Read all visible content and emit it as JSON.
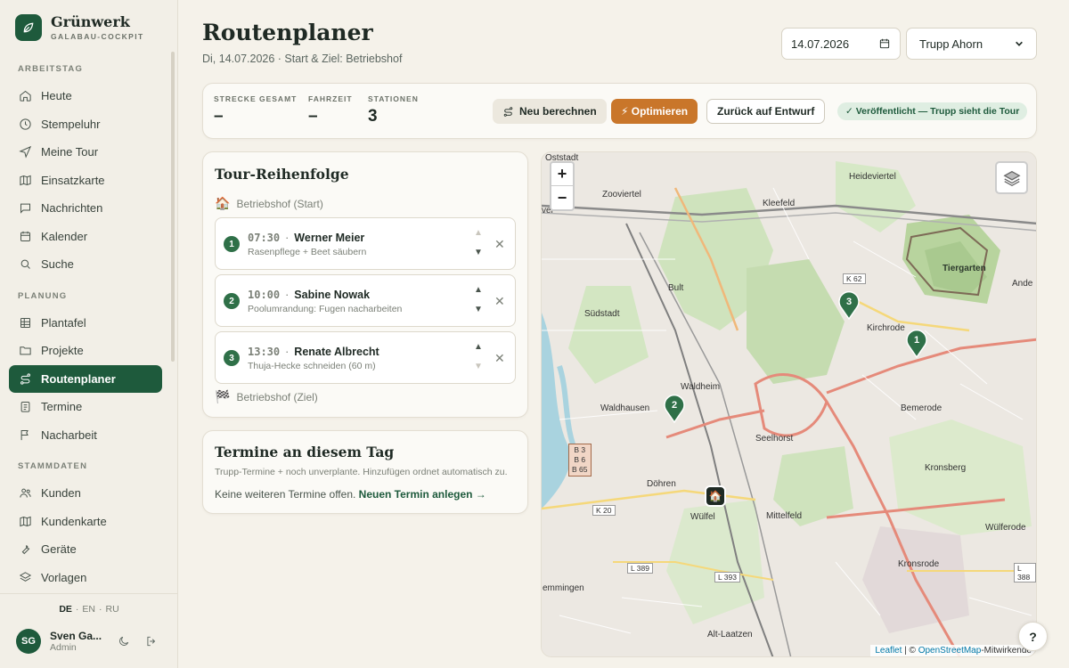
{
  "brand": {
    "name": "Grünwerk",
    "subtitle": "GALABAU-COCKPIT"
  },
  "nav": {
    "sections": [
      {
        "label": "ARBEITSTAG",
        "items": [
          {
            "label": "Heute",
            "icon": "home-icon"
          },
          {
            "label": "Stempeluhr",
            "icon": "clock-icon"
          },
          {
            "label": "Meine Tour",
            "icon": "navigation-icon"
          },
          {
            "label": "Einsatzkarte",
            "icon": "map-icon"
          },
          {
            "label": "Nachrichten",
            "icon": "message-icon"
          },
          {
            "label": "Kalender",
            "icon": "calendar-icon"
          },
          {
            "label": "Suche",
            "icon": "search-icon"
          }
        ]
      },
      {
        "label": "PLANUNG",
        "items": [
          {
            "label": "Plantafel",
            "icon": "grid-icon"
          },
          {
            "label": "Projekte",
            "icon": "folder-icon"
          },
          {
            "label": "Routenplaner",
            "icon": "route-icon",
            "active": true
          },
          {
            "label": "Termine",
            "icon": "clipboard-icon"
          },
          {
            "label": "Nacharbeit",
            "icon": "flag-icon"
          }
        ]
      },
      {
        "label": "STAMMDATEN",
        "items": [
          {
            "label": "Kunden",
            "icon": "users-icon"
          },
          {
            "label": "Kundenkarte",
            "icon": "map-icon"
          },
          {
            "label": "Geräte",
            "icon": "tool-icon"
          },
          {
            "label": "Vorlagen",
            "icon": "layers-icon"
          }
        ]
      }
    ]
  },
  "languages": [
    "DE",
    "EN",
    "RU"
  ],
  "user": {
    "initials": "SG",
    "name": "Sven Ga...",
    "role": "Admin"
  },
  "header": {
    "title": "Routenplaner",
    "subtitle": "Di, 14.07.2026 · Start & Ziel: Betriebshof",
    "date_value": "14.07.2026",
    "team_value": "Trupp Ahorn"
  },
  "stats": {
    "distance_label": "STRECKE GESAMT",
    "distance_value": "–",
    "duration_label": "FAHRZEIT",
    "duration_value": "–",
    "stations_label": "STATIONEN",
    "stations_value": "3"
  },
  "actions": {
    "recalc": "Neu berechnen",
    "optimize": "⚡ Optimieren",
    "draft": "Zurück auf Entwurf",
    "published": "✓ Veröffentlicht — Trupp sieht die Tour"
  },
  "tour": {
    "title": "Tour-Reihenfolge",
    "start": "Betriebshof (Start)",
    "end": "Betriebshof (Ziel)",
    "stops": [
      {
        "num": "1",
        "time": "07:30",
        "name": "Werner Meier",
        "desc": "Rasenpflege + Beet säubern"
      },
      {
        "num": "2",
        "time": "10:00",
        "name": "Sabine Nowak",
        "desc": "Poolumrandung: Fugen nacharbeiten"
      },
      {
        "num": "3",
        "time": "13:30",
        "name": "Renate Albrecht",
        "desc": "Thuja-Hecke schneiden (60 m)"
      }
    ]
  },
  "termine": {
    "title": "Termine an diesem Tag",
    "hint": "Trupp-Termine + noch unverplante. Hinzufügen ordnet automatisch zu.",
    "empty": "Keine weiteren Termine offen. ",
    "link": "Neuen Termin anlegen →"
  },
  "map": {
    "labels": [
      "Oststadt",
      "Zooviertel",
      "Kleefeld",
      "Heideviertel",
      "Südstadt",
      "Bult",
      "Tiergarten",
      "Kirchrode",
      "Waldheim",
      "Waldhausen",
      "Bemerode",
      "Seelhorst",
      "Döhren",
      "Kronsberg",
      "Wülfel",
      "Mittelfeld",
      "Wülferode",
      "Kronsrode",
      "emmingen",
      "Alt-Laatzen",
      "Ande",
      "ver"
    ],
    "roads": [
      "K 62",
      "K 20",
      "L 389",
      "L 393",
      "L 388",
      "B 3",
      "B 6",
      "B 65"
    ],
    "attribution_link": "Leaflet",
    "attribution_text": " | © ",
    "attribution_osm": "OpenStreetMap",
    "attribution_rest": "-Mitwirkende",
    "zoom_in": "+",
    "zoom_out": "−",
    "help": "?"
  }
}
